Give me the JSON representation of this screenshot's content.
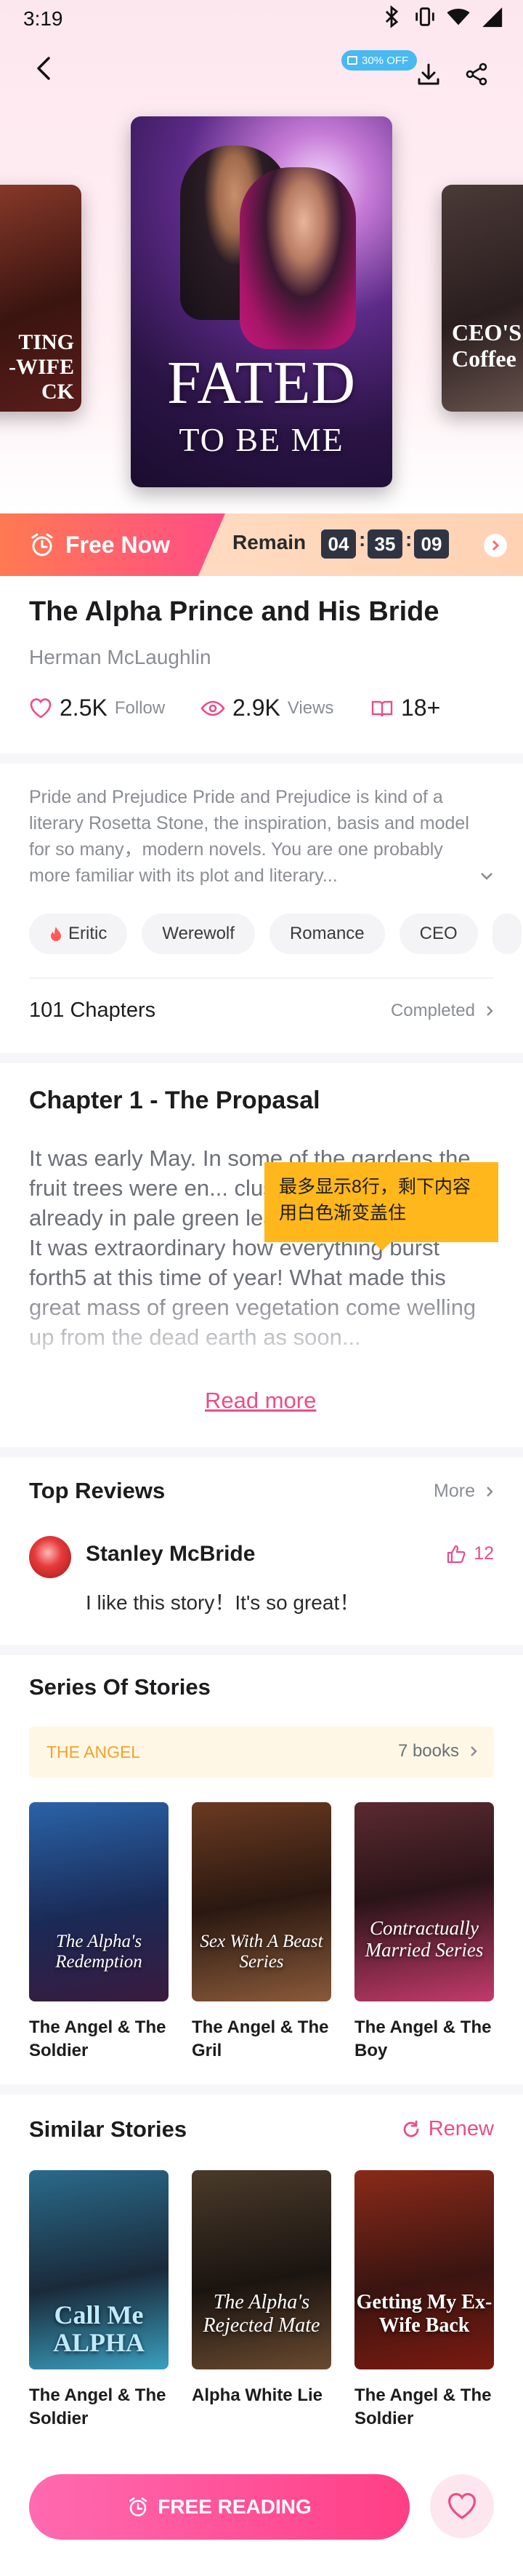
{
  "status_bar": {
    "time": "3:19"
  },
  "header": {
    "sale_badge": "30% OFF"
  },
  "covers": {
    "main": {
      "line1": "FATED",
      "line2": "TO BE ME"
    },
    "left": {
      "text": "TING\n-WIFE\nCK"
    },
    "right": {
      "text": "CEO'S\nCoffee"
    }
  },
  "free_bar": {
    "label": "Free Now",
    "remain_label": "Remain",
    "hours": "04",
    "minutes": "35",
    "seconds": "09"
  },
  "book": {
    "title": "The Alpha Prince and His Bride",
    "author": "Herman McLaughlin",
    "follows": "2.5K",
    "follow_label": "Follow",
    "views": "2.9K",
    "views_label": "Views",
    "age": "18+",
    "description": "Pride and Prejudice Pride and Prejudice is kind of a literary Rosetta Stone, the inspiration, basis and model for so many，modern novels. You are one probably more familiar with its plot and literary...",
    "tags": [
      "Eritic",
      "Werewolf",
      "Romance",
      "CEO"
    ],
    "chapters": "101 Chapters",
    "status": "Completed"
  },
  "chapter": {
    "title": "Chapter 1 - The Propasal",
    "text": "It was early May. In some of the gardens the fruit trees were en... clusters of daffodils. T... already in pale green leaf.\nIt was extraordinary how everything burst forth5 at this time of year! What made this great mass of green vegetation come welling up from the dead earth as soon...",
    "tooltip": "最多显示8行，剩下内容用白色渐变盖住",
    "read_more": "Read more"
  },
  "reviews": {
    "title": "Top Reviews",
    "more": "More",
    "items": [
      {
        "name": "Stanley McBride",
        "likes": "12",
        "text": "I like this story！It's so great！"
      }
    ]
  },
  "series": {
    "title": "Series Of Stories",
    "name": "THE ANGEL",
    "count": "7 books",
    "books": [
      {
        "title": "The Angel & The Soldier",
        "cover_text": "The Alpha's Redemption"
      },
      {
        "title": "The Angel & The Gril",
        "cover_text": "Sex With A Beast Series"
      },
      {
        "title": "The Angel & The Boy",
        "cover_text": "Contractually Married Series"
      }
    ]
  },
  "similar": {
    "title": "Similar Stories",
    "renew": "Renew",
    "books": [
      {
        "title": "The Angel & The Soldier",
        "cover_text": "Call Me ALPHA"
      },
      {
        "title": "Alpha White Lie",
        "cover_text": "The Alpha's Rejected Mate"
      },
      {
        "title": "The Angel & The Soldier",
        "cover_text": "Getting My Ex-Wife Back"
      }
    ]
  },
  "cta": {
    "label": "FREE READING"
  },
  "colors": {
    "accent": "#ec4d8a",
    "timer_bg": "#2f3442",
    "tooltip": "#ffb71c",
    "series_label": "#f2a22a"
  }
}
